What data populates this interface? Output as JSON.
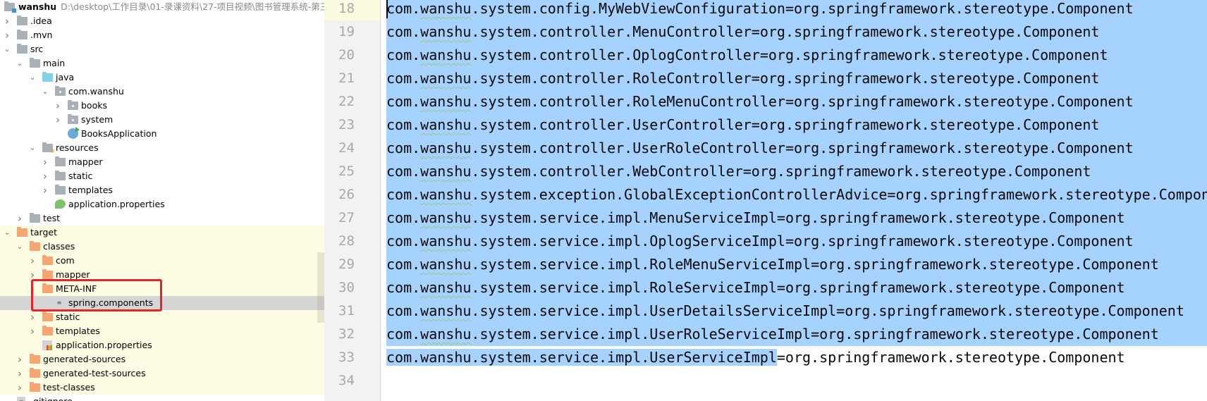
{
  "project_tree": {
    "root": {
      "name": "wanshu",
      "path": "D:\\desktop\\工作目录\\01-录课资料\\27-项目视频\\图书管理系统-第三版\\"
    },
    "items": [
      {
        "label": ".idea",
        "level": 1,
        "arrow": "collapsed",
        "icon": "folder-gray"
      },
      {
        "label": ".mvn",
        "level": 1,
        "arrow": "collapsed",
        "icon": "folder-gray"
      },
      {
        "label": "src",
        "level": 1,
        "arrow": "expanded",
        "icon": "folder-gray"
      },
      {
        "label": "main",
        "level": 2,
        "arrow": "expanded",
        "icon": "folder-gray"
      },
      {
        "label": "java",
        "level": 3,
        "arrow": "expanded",
        "icon": "folder-blue"
      },
      {
        "label": "com.wanshu",
        "level": 4,
        "arrow": "expanded",
        "icon": "package"
      },
      {
        "label": "books",
        "level": 5,
        "arrow": "collapsed",
        "icon": "package"
      },
      {
        "label": "system",
        "level": 5,
        "arrow": "collapsed",
        "icon": "package"
      },
      {
        "label": "BooksApplication",
        "level": 5,
        "arrow": "none",
        "icon": "spring-app"
      },
      {
        "label": "resources",
        "level": 3,
        "arrow": "expanded",
        "icon": "folder-resources"
      },
      {
        "label": "mapper",
        "level": 4,
        "arrow": "collapsed",
        "icon": "folder-gray"
      },
      {
        "label": "static",
        "level": 4,
        "arrow": "collapsed",
        "icon": "folder-gray"
      },
      {
        "label": "templates",
        "level": 4,
        "arrow": "collapsed",
        "icon": "folder-gray"
      },
      {
        "label": "application.properties",
        "level": 4,
        "arrow": "none",
        "icon": "spring-properties"
      },
      {
        "label": "test",
        "level": 2,
        "arrow": "collapsed",
        "icon": "folder-gray"
      },
      {
        "label": "target",
        "level": 1,
        "arrow": "expanded",
        "icon": "folder-orange",
        "excluded": true
      },
      {
        "label": "classes",
        "level": 2,
        "arrow": "expanded",
        "icon": "folder-orange",
        "excluded": true
      },
      {
        "label": "com",
        "level": 3,
        "arrow": "collapsed",
        "icon": "folder-orange",
        "excluded": true
      },
      {
        "label": "mapper",
        "level": 3,
        "arrow": "collapsed",
        "icon": "folder-orange",
        "excluded": true
      },
      {
        "label": "META-INF",
        "level": 3,
        "arrow": "expanded",
        "icon": "folder-orange",
        "excluded": true
      },
      {
        "label": "spring.components",
        "level": 4,
        "arrow": "none",
        "icon": "text-file",
        "excluded": true,
        "selected": true
      },
      {
        "label": "static",
        "level": 3,
        "arrow": "collapsed",
        "icon": "folder-orange",
        "excluded": true
      },
      {
        "label": "templates",
        "level": 3,
        "arrow": "collapsed",
        "icon": "folder-orange",
        "excluded": true
      },
      {
        "label": "application.properties",
        "level": 3,
        "arrow": "none",
        "icon": "properties-file",
        "excluded": true
      },
      {
        "label": "generated-sources",
        "level": 2,
        "arrow": "collapsed",
        "icon": "folder-orange",
        "excluded": true
      },
      {
        "label": "generated-test-sources",
        "level": 2,
        "arrow": "collapsed",
        "icon": "folder-orange",
        "excluded": true
      },
      {
        "label": "test-classes",
        "level": 2,
        "arrow": "collapsed",
        "icon": "folder-orange",
        "excluded": true
      },
      {
        "label": ".gitignore",
        "level": 1,
        "arrow": "none",
        "icon": "text-file"
      }
    ]
  },
  "colors": {
    "selection": "#a6d2ff",
    "excluded_bg": "#fefde3",
    "highlight_box": "#e6222a",
    "tree_selected": "#d5d5d5"
  },
  "editor": {
    "current_line": 18,
    "lines": [
      {
        "n": "18",
        "text": "com.wanshu.system.config.MyWebViewConfiguration=org.springframework.stereotype.Component"
      },
      {
        "n": "19",
        "text": "com.wanshu.system.controller.MenuController=org.springframework.stereotype.Component"
      },
      {
        "n": "20",
        "text": "com.wanshu.system.controller.OplogController=org.springframework.stereotype.Component"
      },
      {
        "n": "21",
        "text": "com.wanshu.system.controller.RoleController=org.springframework.stereotype.Component"
      },
      {
        "n": "22",
        "text": "com.wanshu.system.controller.RoleMenuController=org.springframework.stereotype.Component"
      },
      {
        "n": "23",
        "text": "com.wanshu.system.controller.UserController=org.springframework.stereotype.Component"
      },
      {
        "n": "24",
        "text": "com.wanshu.system.controller.UserRoleController=org.springframework.stereotype.Component"
      },
      {
        "n": "25",
        "text": "com.wanshu.system.controller.WebController=org.springframework.stereotype.Component"
      },
      {
        "n": "26",
        "text": "com.wanshu.system.exception.GlobalExceptionControllerAdvice=org.springframework.stereotype.Component"
      },
      {
        "n": "27",
        "text": "com.wanshu.system.service.impl.MenuServiceImpl=org.springframework.stereotype.Component"
      },
      {
        "n": "28",
        "text": "com.wanshu.system.service.impl.OplogServiceImpl=org.springframework.stereotype.Component"
      },
      {
        "n": "29",
        "text": "com.wanshu.system.service.impl.RoleMenuServiceImpl=org.springframework.stereotype.Component"
      },
      {
        "n": "30",
        "text": "com.wanshu.system.service.impl.RoleServiceImpl=org.springframework.stereotype.Component"
      },
      {
        "n": "31",
        "text": "com.wanshu.system.service.impl.UserDetailsServiceImpl=org.springframework.stereotype.Component"
      },
      {
        "n": "32",
        "text": "com.wanshu.system.service.impl.UserRoleServiceImpl=org.springframework.stereotype.Component"
      },
      {
        "n": "33",
        "text": "com.wanshu.system.service.impl.UserServiceImpl=org.springframework.stereotype.Component",
        "selected_part": "com.wanshu.system.service.impl.UserServiceImpl",
        "rest": "=org.springframework.stereotype.Component"
      },
      {
        "n": "34",
        "text": ""
      }
    ]
  }
}
